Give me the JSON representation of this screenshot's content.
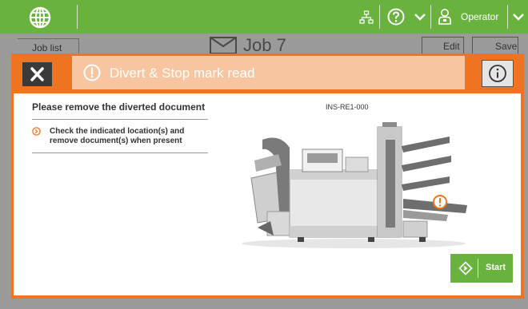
{
  "topbar": {
    "user_label": "Operator",
    "globe_icon": "globe-icon",
    "network_icon": "network-icon",
    "help_icon": "help-icon",
    "user_icon": "operator-icon",
    "accent": "#6ab23e"
  },
  "background": {
    "job_list_label": "Job list",
    "job_title": "Job 7",
    "edit_label": "Edit",
    "save_label": "Save"
  },
  "dialog": {
    "title": "Divert & Stop mark read",
    "accent": "#ee7422",
    "instruction_title": "Please remove the diverted document",
    "step_text": "Check the indicated location(s) and remove document(s) when present",
    "machine_id": "INS-RE1-000",
    "start_label": "Start"
  }
}
